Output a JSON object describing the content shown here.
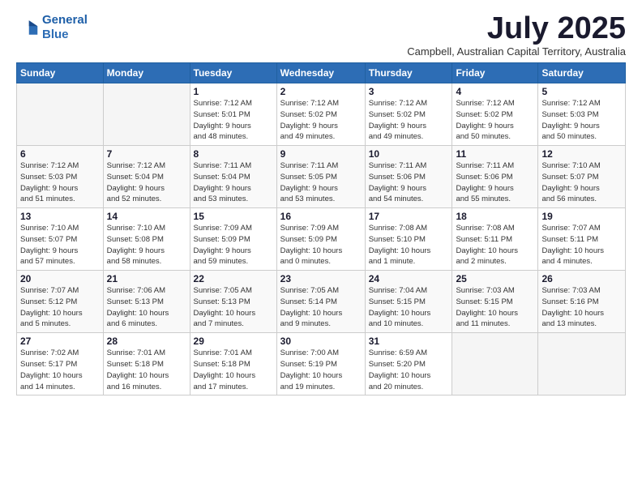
{
  "logo": {
    "line1": "General",
    "line2": "Blue"
  },
  "title": "July 2025",
  "subtitle": "Campbell, Australian Capital Territory, Australia",
  "weekdays": [
    "Sunday",
    "Monday",
    "Tuesday",
    "Wednesday",
    "Thursday",
    "Friday",
    "Saturday"
  ],
  "weeks": [
    [
      {
        "day": "",
        "info": ""
      },
      {
        "day": "",
        "info": ""
      },
      {
        "day": "1",
        "info": "Sunrise: 7:12 AM\nSunset: 5:01 PM\nDaylight: 9 hours\nand 48 minutes."
      },
      {
        "day": "2",
        "info": "Sunrise: 7:12 AM\nSunset: 5:02 PM\nDaylight: 9 hours\nand 49 minutes."
      },
      {
        "day": "3",
        "info": "Sunrise: 7:12 AM\nSunset: 5:02 PM\nDaylight: 9 hours\nand 49 minutes."
      },
      {
        "day": "4",
        "info": "Sunrise: 7:12 AM\nSunset: 5:02 PM\nDaylight: 9 hours\nand 50 minutes."
      },
      {
        "day": "5",
        "info": "Sunrise: 7:12 AM\nSunset: 5:03 PM\nDaylight: 9 hours\nand 50 minutes."
      }
    ],
    [
      {
        "day": "6",
        "info": "Sunrise: 7:12 AM\nSunset: 5:03 PM\nDaylight: 9 hours\nand 51 minutes."
      },
      {
        "day": "7",
        "info": "Sunrise: 7:12 AM\nSunset: 5:04 PM\nDaylight: 9 hours\nand 52 minutes."
      },
      {
        "day": "8",
        "info": "Sunrise: 7:11 AM\nSunset: 5:04 PM\nDaylight: 9 hours\nand 53 minutes."
      },
      {
        "day": "9",
        "info": "Sunrise: 7:11 AM\nSunset: 5:05 PM\nDaylight: 9 hours\nand 53 minutes."
      },
      {
        "day": "10",
        "info": "Sunrise: 7:11 AM\nSunset: 5:06 PM\nDaylight: 9 hours\nand 54 minutes."
      },
      {
        "day": "11",
        "info": "Sunrise: 7:11 AM\nSunset: 5:06 PM\nDaylight: 9 hours\nand 55 minutes."
      },
      {
        "day": "12",
        "info": "Sunrise: 7:10 AM\nSunset: 5:07 PM\nDaylight: 9 hours\nand 56 minutes."
      }
    ],
    [
      {
        "day": "13",
        "info": "Sunrise: 7:10 AM\nSunset: 5:07 PM\nDaylight: 9 hours\nand 57 minutes."
      },
      {
        "day": "14",
        "info": "Sunrise: 7:10 AM\nSunset: 5:08 PM\nDaylight: 9 hours\nand 58 minutes."
      },
      {
        "day": "15",
        "info": "Sunrise: 7:09 AM\nSunset: 5:09 PM\nDaylight: 9 hours\nand 59 minutes."
      },
      {
        "day": "16",
        "info": "Sunrise: 7:09 AM\nSunset: 5:09 PM\nDaylight: 10 hours\nand 0 minutes."
      },
      {
        "day": "17",
        "info": "Sunrise: 7:08 AM\nSunset: 5:10 PM\nDaylight: 10 hours\nand 1 minute."
      },
      {
        "day": "18",
        "info": "Sunrise: 7:08 AM\nSunset: 5:11 PM\nDaylight: 10 hours\nand 2 minutes."
      },
      {
        "day": "19",
        "info": "Sunrise: 7:07 AM\nSunset: 5:11 PM\nDaylight: 10 hours\nand 4 minutes."
      }
    ],
    [
      {
        "day": "20",
        "info": "Sunrise: 7:07 AM\nSunset: 5:12 PM\nDaylight: 10 hours\nand 5 minutes."
      },
      {
        "day": "21",
        "info": "Sunrise: 7:06 AM\nSunset: 5:13 PM\nDaylight: 10 hours\nand 6 minutes."
      },
      {
        "day": "22",
        "info": "Sunrise: 7:05 AM\nSunset: 5:13 PM\nDaylight: 10 hours\nand 7 minutes."
      },
      {
        "day": "23",
        "info": "Sunrise: 7:05 AM\nSunset: 5:14 PM\nDaylight: 10 hours\nand 9 minutes."
      },
      {
        "day": "24",
        "info": "Sunrise: 7:04 AM\nSunset: 5:15 PM\nDaylight: 10 hours\nand 10 minutes."
      },
      {
        "day": "25",
        "info": "Sunrise: 7:03 AM\nSunset: 5:15 PM\nDaylight: 10 hours\nand 11 minutes."
      },
      {
        "day": "26",
        "info": "Sunrise: 7:03 AM\nSunset: 5:16 PM\nDaylight: 10 hours\nand 13 minutes."
      }
    ],
    [
      {
        "day": "27",
        "info": "Sunrise: 7:02 AM\nSunset: 5:17 PM\nDaylight: 10 hours\nand 14 minutes."
      },
      {
        "day": "28",
        "info": "Sunrise: 7:01 AM\nSunset: 5:18 PM\nDaylight: 10 hours\nand 16 minutes."
      },
      {
        "day": "29",
        "info": "Sunrise: 7:01 AM\nSunset: 5:18 PM\nDaylight: 10 hours\nand 17 minutes."
      },
      {
        "day": "30",
        "info": "Sunrise: 7:00 AM\nSunset: 5:19 PM\nDaylight: 10 hours\nand 19 minutes."
      },
      {
        "day": "31",
        "info": "Sunrise: 6:59 AM\nSunset: 5:20 PM\nDaylight: 10 hours\nand 20 minutes."
      },
      {
        "day": "",
        "info": ""
      },
      {
        "day": "",
        "info": ""
      }
    ]
  ]
}
